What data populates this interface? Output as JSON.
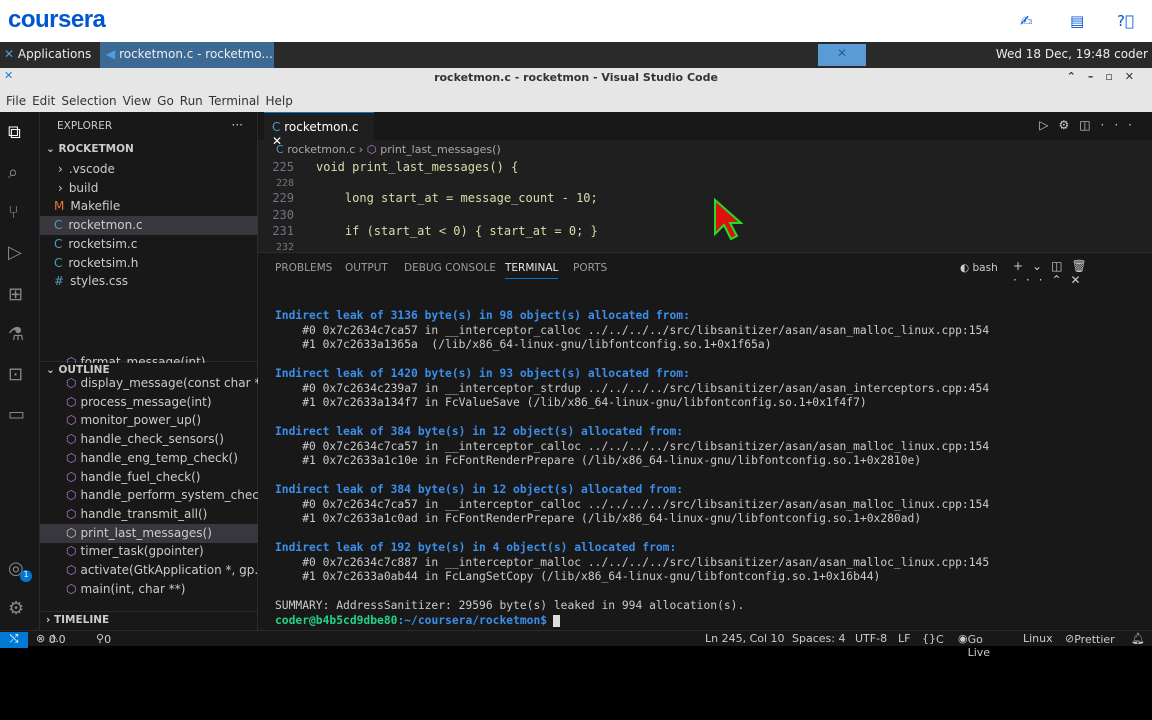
{
  "coursera": {
    "logo": "coursera"
  },
  "taskbar": {
    "applications": "Applications",
    "window": "rocketmon.c - rocketmo...",
    "clock": "Wed 18 Dec, 19:48 coder"
  },
  "window": {
    "title": "rocketmon.c - rocketmon - Visual Studio Code"
  },
  "menu": [
    "File",
    "Edit",
    "Selection",
    "View",
    "Go",
    "Run",
    "Terminal",
    "Help"
  ],
  "sidebar": {
    "explorer": "EXPLORER",
    "root": "ROCKETMON",
    "files": [
      {
        "icon": "›",
        "name": ".vscode"
      },
      {
        "icon": "›",
        "name": "build"
      },
      {
        "icon": "M",
        "name": "Makefile"
      },
      {
        "icon": "C",
        "name": "rocketmon.c"
      },
      {
        "icon": "C",
        "name": "rocketsim.c"
      },
      {
        "icon": "C",
        "name": "rocketsim.h"
      },
      {
        "icon": "#",
        "name": "styles.css"
      }
    ],
    "outline": "OUTLINE",
    "outline_items": [
      "format_message(int)",
      "display_message(const char *)",
      "process_message(int)",
      "monitor_power_up()",
      "handle_check_sensors()",
      "handle_eng_temp_check()",
      "handle_fuel_check()",
      "handle_perform_system_chec...",
      "handle_transmit_all()",
      "print_last_messages()",
      "timer_task(gpointer)",
      "activate(GtkApplication *, gp...",
      "main(int, char **)"
    ],
    "timeline": "TIMELINE"
  },
  "editor": {
    "tab": "rocketmon.c",
    "breadcrumb_file": "rocketmon.c",
    "breadcrumb_symbol": "print_last_messages()",
    "lines": [
      {
        "n": "225",
        "t": "void print_last_messages() {"
      },
      {
        "n": "228",
        "t": ""
      },
      {
        "n": "229",
        "t": "    long start_at = message_count - 10;"
      },
      {
        "n": "230",
        "t": ""
      },
      {
        "n": "231",
        "t": "    if (start_at < 0) { start_at = 0; }"
      },
      {
        "n": "232",
        "t": ""
      }
    ]
  },
  "panel": {
    "tabs": [
      "PROBLEMS",
      "OUTPUT",
      "DEBUG CONSOLE",
      "TERMINAL",
      "PORTS"
    ],
    "active": "TERMINAL",
    "shell": "bash"
  },
  "terminal": {
    "blocks": [
      {
        "h": "Indirect leak of 3136 byte(s) in 98 object(s) allocated from:",
        "l": [
          "    #0 0x7c2634c7ca57 in __interceptor_calloc ../../../../src/libsanitizer/asan/asan_malloc_linux.cpp:154",
          "    #1 0x7c2633a1365a  (/lib/x86_64-linux-gnu/libfontconfig.so.1+0x1f65a)"
        ]
      },
      {
        "h": "Indirect leak of 1420 byte(s) in 93 object(s) allocated from:",
        "l": [
          "    #0 0x7c2634c239a7 in __interceptor_strdup ../../../../src/libsanitizer/asan/asan_interceptors.cpp:454",
          "    #1 0x7c2633a134f7 in FcValueSave (/lib/x86_64-linux-gnu/libfontconfig.so.1+0x1f4f7)"
        ]
      },
      {
        "h": "Indirect leak of 384 byte(s) in 12 object(s) allocated from:",
        "l": [
          "    #0 0x7c2634c7ca57 in __interceptor_calloc ../../../../src/libsanitizer/asan/asan_malloc_linux.cpp:154",
          "    #1 0x7c2633a1c10e in FcFontRenderPrepare (/lib/x86_64-linux-gnu/libfontconfig.so.1+0x2810e)"
        ]
      },
      {
        "h": "Indirect leak of 384 byte(s) in 12 object(s) allocated from:",
        "l": [
          "    #0 0x7c2634c7ca57 in __interceptor_calloc ../../../../src/libsanitizer/asan/asan_malloc_linux.cpp:154",
          "    #1 0x7c2633a1c0ad in FcFontRenderPrepare (/lib/x86_64-linux-gnu/libfontconfig.so.1+0x280ad)"
        ]
      },
      {
        "h": "Indirect leak of 192 byte(s) in 4 object(s) allocated from:",
        "l": [
          "    #0 0x7c2634c7c887 in __interceptor_malloc ../../../../src/libsanitizer/asan/asan_malloc_linux.cpp:145",
          "    #1 0x7c2633a0ab44 in FcLangSetCopy (/lib/x86_64-linux-gnu/libfontconfig.so.1+0x16b44)"
        ]
      }
    ],
    "summary": "SUMMARY: AddressSanitizer: 29596 byte(s) leaked in 994 allocation(s).",
    "prompt": "coder@b4b5cd9dbe80",
    "path": ":~/coursera/rocketmon$"
  },
  "status": {
    "errors": "0",
    "warnings": "0",
    "ports": "0",
    "position": "Ln 245, Col 10",
    "spaces": "Spaces: 4",
    "encoding": "UTF-8",
    "eol": "LF",
    "lang": "C",
    "golive": "Go Live",
    "os": "Linux",
    "prettier": "Prettier",
    "badge": "1"
  },
  "colors": {
    "accent": "#0078d4",
    "coursera": "#0056d2",
    "terminal_header": "#3b8eea",
    "prompt": "#23d18b"
  }
}
